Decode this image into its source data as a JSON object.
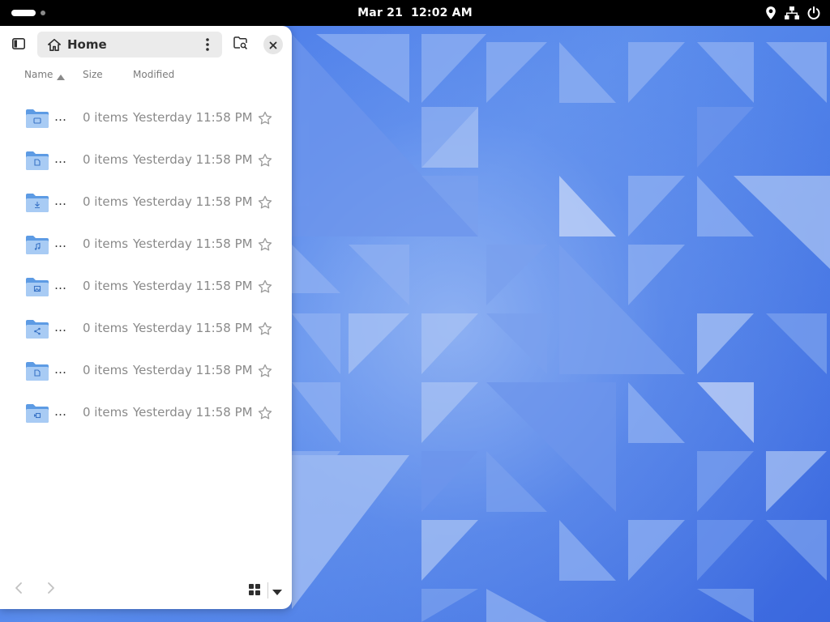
{
  "topbar": {
    "date": "Mar 21",
    "time": "12:02 AM",
    "tray_icons": [
      "location-icon",
      "network-icon",
      "power-icon"
    ]
  },
  "window": {
    "location_title": "Home",
    "columns": {
      "name": "Name",
      "size": "Size",
      "modified": "Modified"
    },
    "sort": {
      "column": "name",
      "direction": "ascending"
    },
    "rows": [
      {
        "name": "…",
        "icon": "folder-icon",
        "size": "0 items",
        "modified": "Yesterday 11:58 PM"
      },
      {
        "name": "…",
        "icon": "document-icon",
        "size": "0 items",
        "modified": "Yesterday 11:58 PM"
      },
      {
        "name": "…",
        "icon": "download-icon",
        "size": "0 items",
        "modified": "Yesterday 11:58 PM"
      },
      {
        "name": "…",
        "icon": "music-icon",
        "size": "0 items",
        "modified": "Yesterday 11:58 PM"
      },
      {
        "name": "…",
        "icon": "pictures-icon",
        "size": "0 items",
        "modified": "Yesterday 11:58 PM"
      },
      {
        "name": "…",
        "icon": "share-icon",
        "size": "0 items",
        "modified": "Yesterday 11:58 PM"
      },
      {
        "name": "…",
        "icon": "templates-icon",
        "size": "0 items",
        "modified": "Yesterday 11:58 PM"
      },
      {
        "name": "…",
        "icon": "video-icon",
        "size": "0 items",
        "modified": "Yesterday 11:58 PM"
      }
    ]
  },
  "colors": {
    "folder_blue": "#5d9be4",
    "folder_light": "#a8cbf4",
    "topbar_bg": "#000000",
    "window_bg": "#ffffff"
  }
}
